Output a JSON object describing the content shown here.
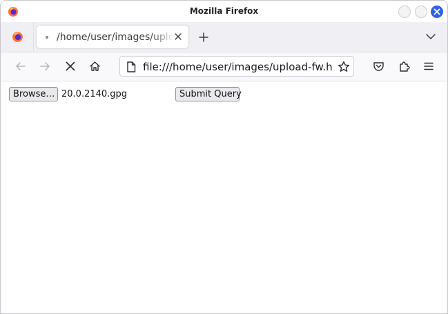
{
  "window": {
    "title": "Mozilla Firefox"
  },
  "tabs": [
    {
      "label": "/home/user/images/upload-fw.html",
      "active": true
    }
  ],
  "navbar": {
    "url": "file:///home/user/images/upload-fw.html"
  },
  "page": {
    "browse_label": "Browse…",
    "file_name": "20.0.2140.gpg",
    "submit_label": "Submit Query"
  },
  "colors": {
    "close_button": "#2f64e6",
    "tabstrip_bg": "#f0f0f4",
    "navbar_bg": "#f9f9fb"
  },
  "icons": [
    "firefox-logo-icon",
    "close-icon",
    "plus-icon",
    "chevron-down-icon",
    "back-arrow-icon",
    "forward-arrow-icon",
    "stop-icon",
    "home-icon",
    "document-icon",
    "star-icon",
    "pocket-icon",
    "extensions-icon",
    "menu-icon"
  ]
}
